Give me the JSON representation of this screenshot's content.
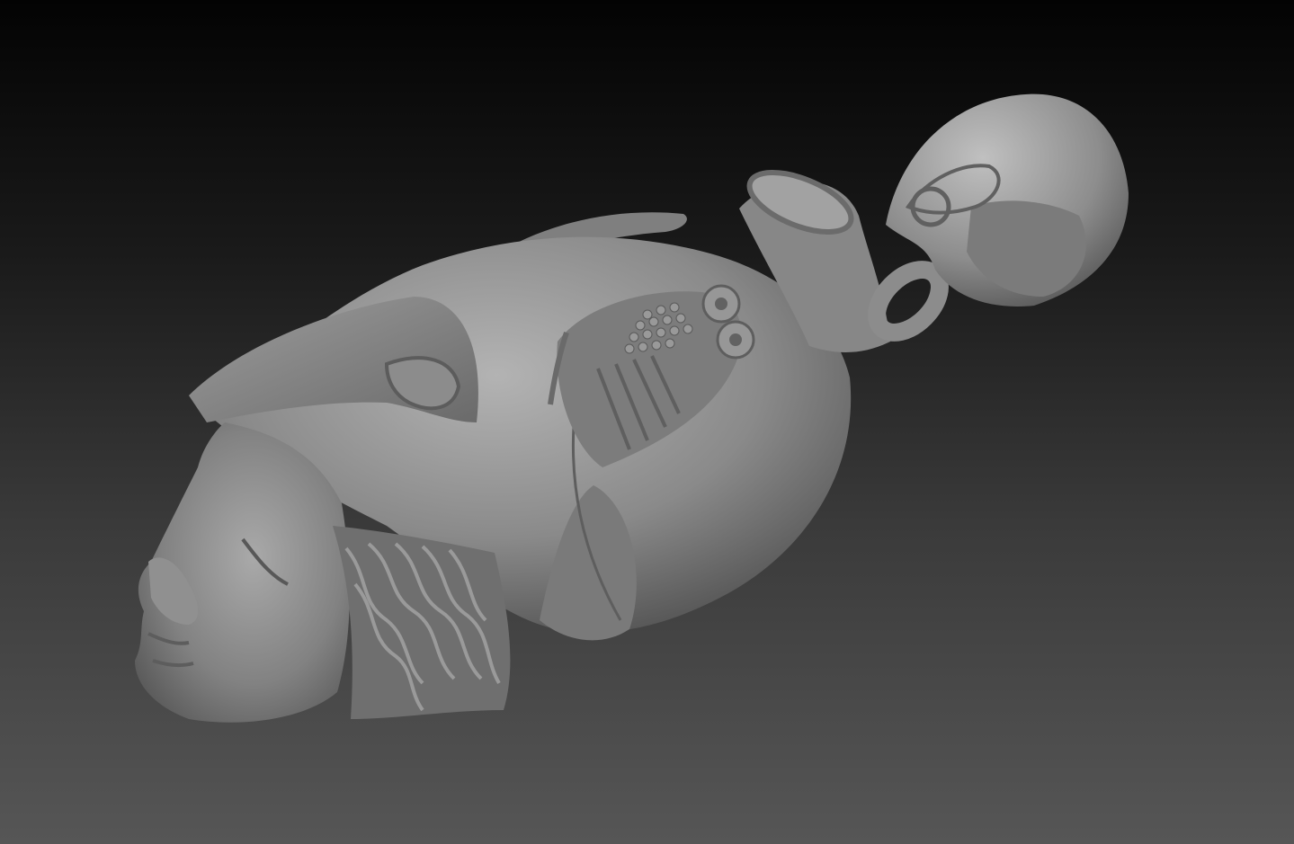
{
  "scene": {
    "subject_icon": "sculpted-helmeted-head-pendant",
    "background_top_color": "#030303",
    "background_bottom_color": "#565656",
    "material_color": "#8a8a8a"
  }
}
